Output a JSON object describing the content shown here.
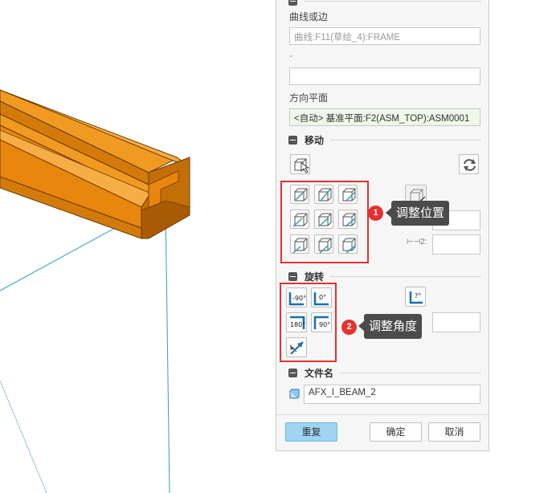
{
  "panel": {
    "curve_label": "曲线或边",
    "curve_value": "曲线:F11(草绘_4):FRAME",
    "dash_label": "-",
    "dir_label": "方向平面",
    "dir_value": "<自动> 基准平面:F2(ASM_TOP):ASM0001",
    "move_section": "移动",
    "rotate_section": "旋转",
    "filename_section": "文件名",
    "offset2_label": "2:",
    "filename_value": "AFX_I_BEAM_2",
    "rotate_buttons": [
      "-90°",
      "0°",
      "180°",
      "90°"
    ],
    "reset_button": "重复",
    "ok_button": "确定",
    "cancel_button": "取消"
  },
  "callouts": [
    {
      "num": "1",
      "text": "调整位置"
    },
    {
      "num": "2",
      "text": "调整角度"
    }
  ],
  "colors": {
    "beam": "#e8860e",
    "beam_dark": "#a95a05",
    "accent_red": "#e5312f",
    "primary_btn": "#9fd4f2",
    "sketch_line": "#2f9fbf"
  }
}
